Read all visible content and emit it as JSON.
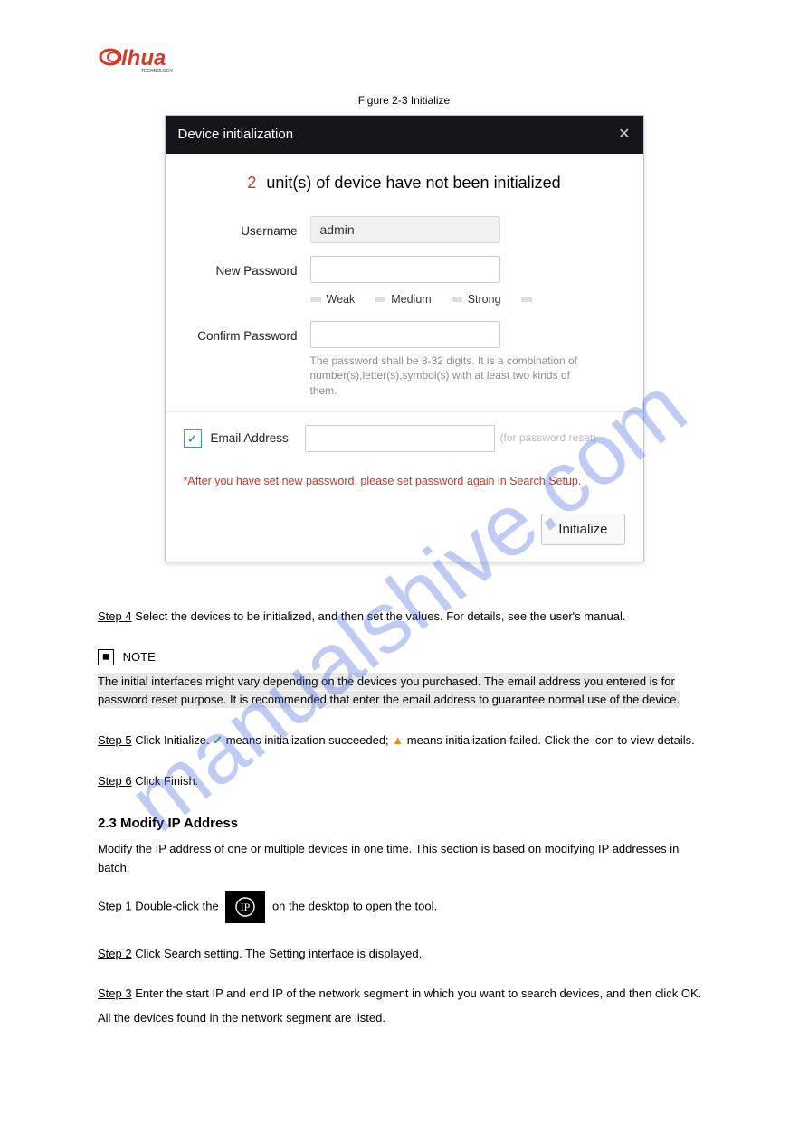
{
  "logo": {
    "brand": "alhua",
    "sub": "TECHNOLOGY"
  },
  "figure": {
    "caption": "Figure 2-3 Initialize"
  },
  "dialog": {
    "title": "Device initialization",
    "close_glyph": "✕",
    "banner": {
      "count": "2",
      "text": "unit(s) of device have not been initialized"
    },
    "username": {
      "label": "Username",
      "value": "admin"
    },
    "newpwd": {
      "label": "New Password",
      "value": ""
    },
    "strength": {
      "weak": "Weak",
      "medium": "Medium",
      "strong": "Strong"
    },
    "confirm": {
      "label": "Confirm Password",
      "value": "",
      "hint": "The password shall be 8-32 digits. It is a combination of number(s),letter(s),symbol(s) with at least two kinds of them."
    },
    "email": {
      "label": "Email Address",
      "value": "",
      "hint": "(for password reset)",
      "checked": true,
      "check_glyph": "✓"
    },
    "warning": "*After you have set new password, please set password again in Search Setup.",
    "button": "Initialize"
  },
  "steps": {
    "s4": {
      "label": "Step 4",
      "text": "Select the devices to be initialized, and then set the values. For details, see the user's manual."
    },
    "note": {
      "label": "NOTE",
      "text": "The initial interfaces might vary depending on the devices you purchased. The email address you entered is for password reset purpose. It is recommended that enter the email address to guarantee normal use of the device."
    },
    "s5": {
      "label": "Step 5",
      "text_before": "Click Initialize. ",
      "text_icon1": " means initialization succeeded; ",
      "text_icon2": " means initialization failed. Click the icon to view details."
    },
    "s6": {
      "label": "Step 6",
      "text": "Click Finish."
    }
  },
  "section": {
    "title": "2.3 Modify IP Address",
    "intro": "Modify the IP address of one or multiple devices in one time. This section is based on modifying IP addresses in batch.",
    "m1": {
      "label": "Step 1",
      "text_a": "Double-click the ",
      "text_b": " on the desktop to open the tool."
    },
    "m2": {
      "label": "Step 2",
      "text": "Click Search setting. The Setting interface is displayed."
    },
    "m3": {
      "label": "Step 3",
      "text": "Enter the start IP and end IP of the network segment in which you want to search devices, and then click OK.",
      "text2": "All the devices found in the network segment are listed."
    }
  },
  "icons": {
    "success_glyph": "✓",
    "fail_glyph": "▲",
    "ip_glyph": "ⒾⓅ"
  }
}
